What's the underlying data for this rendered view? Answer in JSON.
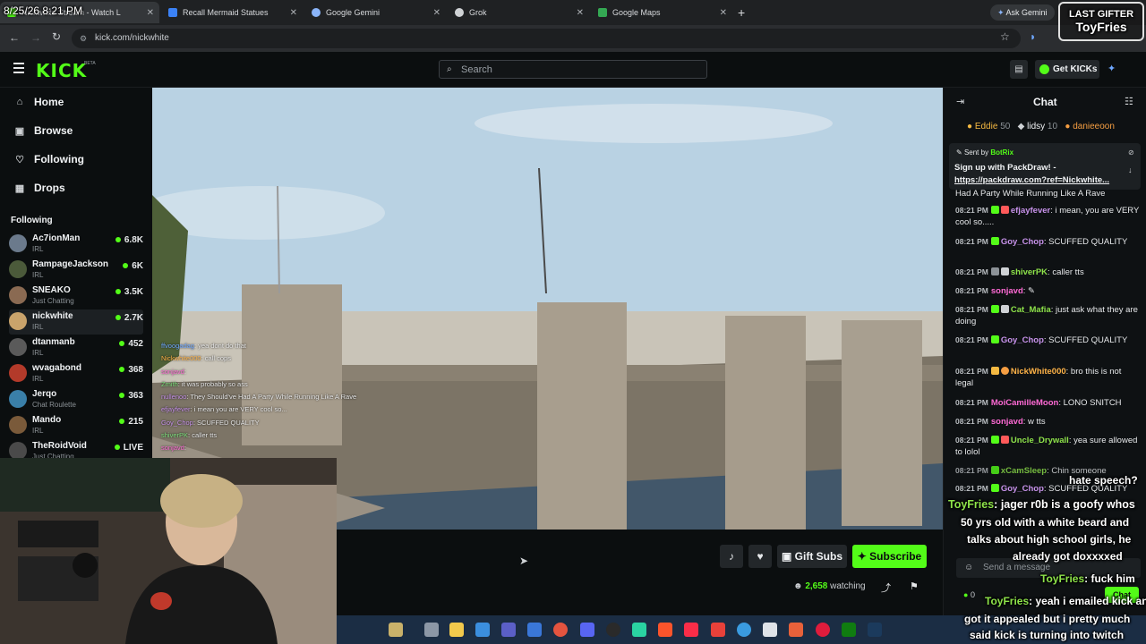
{
  "browser": {
    "overlay_time": "8/25/26 8:21 PM",
    "tabs": [
      {
        "label": "Nickwhite Stream - Watch L",
        "color": "#53fc18"
      },
      {
        "label": "Recall Mermaid Statues",
        "color": "#3b82f6"
      },
      {
        "label": "Google Gemini",
        "color": "#8ab4f8"
      },
      {
        "label": "Grok",
        "color": "#cfd2d5"
      },
      {
        "label": "Google Maps",
        "color": "#34a853"
      }
    ],
    "new_tab": "+",
    "ask_gemini": "Ask Gemini",
    "url": "kick.com/nickwhite"
  },
  "header": {
    "logo": "KICK",
    "logo_tag": "BETA",
    "search_placeholder": "Search",
    "get_kicks": "Get KICKs"
  },
  "sidebar": {
    "nav": [
      {
        "label": "Home",
        "icon": "home-icon"
      },
      {
        "label": "Browse",
        "icon": "browse-icon"
      },
      {
        "label": "Following",
        "icon": "heart-icon"
      },
      {
        "label": "Drops",
        "icon": "drops-icon"
      }
    ],
    "following_title": "Following",
    "following": [
      {
        "name": "Ac7ionMan",
        "category": "IRL",
        "viewers": "6.8K",
        "color": "#6b7a8c"
      },
      {
        "name": "RampageJackson",
        "category": "IRL",
        "viewers": "6K",
        "color": "#4b5a3a"
      },
      {
        "name": "SNEAKO",
        "category": "Just Chatting",
        "viewers": "3.5K",
        "color": "#8a6a52"
      },
      {
        "name": "nickwhite",
        "category": "IRL",
        "viewers": "2.7K",
        "color": "#c9a36b"
      },
      {
        "name": "dtanmanb",
        "category": "IRL",
        "viewers": "452",
        "color": "#5a5a5a"
      },
      {
        "name": "wvagabond",
        "category": "IRL",
        "viewers": "368",
        "color": "#b33a2a"
      },
      {
        "name": "Jerqo",
        "category": "Chat Roulette",
        "viewers": "363",
        "color": "#3a7fa8"
      },
      {
        "name": "Mando",
        "category": "IRL",
        "viewers": "215",
        "color": "#7a5a3a"
      },
      {
        "name": "TheRoidVoid",
        "category": "Just Chatting",
        "viewers": "LIVE",
        "color": "#4a4a4a"
      }
    ]
  },
  "video_chat_overlay": [
    {
      "user": "ffvoogadag",
      "text": "yea dont do that",
      "color": "#6fa8ff"
    },
    {
      "user": "Nickwhite000",
      "text": "call cops",
      "color": "#ffb347"
    },
    {
      "user": "sonjavd",
      "text": "",
      "color": "#ff6ad5"
    },
    {
      "user": "Zmith",
      "text": "it was probably so ass",
      "color": "#7ee07e"
    },
    {
      "user": "nullenoo",
      "text": "They Should've Had A Party While Running Like A Rave",
      "color": "#c792ea"
    },
    {
      "user": "efjayfever",
      "text": "i mean you are VERY cool so...",
      "color": "#c792ea"
    },
    {
      "user": "Goy_Chop",
      "text": "SCUFFED QUALITY",
      "color": "#c792ea"
    },
    {
      "user": "shiverPK",
      "text": "caller tts",
      "color": "#7ee07e"
    },
    {
      "user": "sonjavd",
      "text": "",
      "color": "#ff6ad5"
    }
  ],
  "player": {
    "gift_subs": "Gift Subs",
    "subscribe": "Subscribe",
    "watching_count": "2,658",
    "watching_label": "watching"
  },
  "chat": {
    "title": "Chat",
    "gifters": [
      {
        "name": "Eddie",
        "count": "50",
        "color": "#f5b942"
      },
      {
        "name": "lidsy",
        "count": "10",
        "color": "#cfd2d5"
      },
      {
        "name": "danieeoon",
        "count": "",
        "color": "#f59e42"
      }
    ],
    "pinned": {
      "sent_by_label": "Sent by",
      "sender": "BotRix",
      "text": "Sign up with PackDraw! -",
      "link": "https://packdraw.com?ref=Nickwhite..."
    },
    "cut_line": "Had A Party While Running Like A Rave",
    "messages": [
      {
        "time": "08:21 PM",
        "user": "efjayfever",
        "text": "i mean, you are VERY cool so.....",
        "color": "#c792ea"
      },
      {
        "time": "08:21 PM",
        "user": "Goy_Chop",
        "text": "SCUFFED QUALITY",
        "color": "#c792ea"
      },
      {
        "time": "08:21 PM",
        "user": "shiverPK",
        "text": "caller tts",
        "color": "#8ee34a"
      },
      {
        "time": "08:21 PM",
        "user": "sonjavd",
        "text": "",
        "color": "#ff6ad5"
      },
      {
        "time": "08:21 PM",
        "user": "Cat_Mafia",
        "text": "just ask what they are doing",
        "color": "#8ee34a"
      },
      {
        "time": "08:21 PM",
        "user": "Goy_Chop",
        "text": "SCUFFED QUALITY",
        "color": "#c792ea"
      },
      {
        "time": "08:21 PM",
        "user": "NickWhite000",
        "text": "bro this is not legal",
        "color": "#ffb347"
      },
      {
        "time": "08:21 PM",
        "user": "MoiCamilleMoon",
        "text": "LONO SNITCH",
        "color": "#ff6ad5"
      },
      {
        "time": "08:21 PM",
        "user": "sonjavd",
        "text": "w tts",
        "color": "#ff6ad5"
      },
      {
        "time": "08:21 PM",
        "user": "Uncle_Drywall",
        "text": "yea sure allowed to lolol",
        "color": "#8ee34a"
      },
      {
        "time": "08:21 PM",
        "user": "xCamSleep",
        "text": "Chin someone",
        "color": "#8ee34a"
      },
      {
        "time": "08:21 PM",
        "user": "Goy_Chop",
        "text": "SCUFFED QUALITY",
        "color": "#c792ea"
      }
    ],
    "send_placeholder": "Send a message",
    "chat_button": "Chat",
    "kicks_count": "0"
  },
  "stream_overlay": {
    "last_gifter_label": "LAST GIFTER",
    "last_gifter_name": "ToyFries",
    "tts_lines": [
      {
        "user": "",
        "text": "hate speech?"
      },
      {
        "user": "ToyFries",
        "text": "jager r0b is a goofy whos"
      },
      {
        "user": "",
        "text": "50 yrs old with a white beard and"
      },
      {
        "user": "",
        "text": "talks about high school girls, he"
      },
      {
        "user": "",
        "text": "already got doxxxxed"
      },
      {
        "user": "ToyFries",
        "text": "fuck him"
      },
      {
        "user": "ToyFries",
        "text": "yeah i emailed kick and"
      },
      {
        "user": "",
        "text": "got it appealed but i pretty much"
      },
      {
        "user": "",
        "text": "said kick is turning into twitch"
      }
    ]
  },
  "colors": {
    "kick_green": "#53fc18",
    "background": "#0b0e0f",
    "chat_bg": "#0e1113",
    "taskbar": "#1b2d44"
  }
}
